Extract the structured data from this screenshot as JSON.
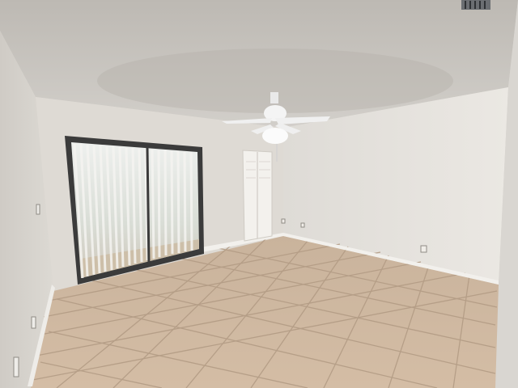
{
  "scene": {
    "subject": "empty-room-interior",
    "elements": [
      "textured-ceiling",
      "ceiling-fan",
      "sliding-glass-door",
      "vertical-blinds",
      "closet-door",
      "tile-floor",
      "baseboards",
      "wall-outlets",
      "ceiling-vent"
    ]
  },
  "colors": {
    "ceiling": "#c9c6c1",
    "wall_left": "#d4d1cb",
    "wall_back": "#e2dfda",
    "wall_right": "#e7e4df",
    "floor": "#cdb49a",
    "grout": "#b19a83",
    "baseboard": "#f2f0ec",
    "blinds": "#e8e6e2",
    "fan": "#f1f1f1",
    "door_frame": "#3b3b3b"
  }
}
